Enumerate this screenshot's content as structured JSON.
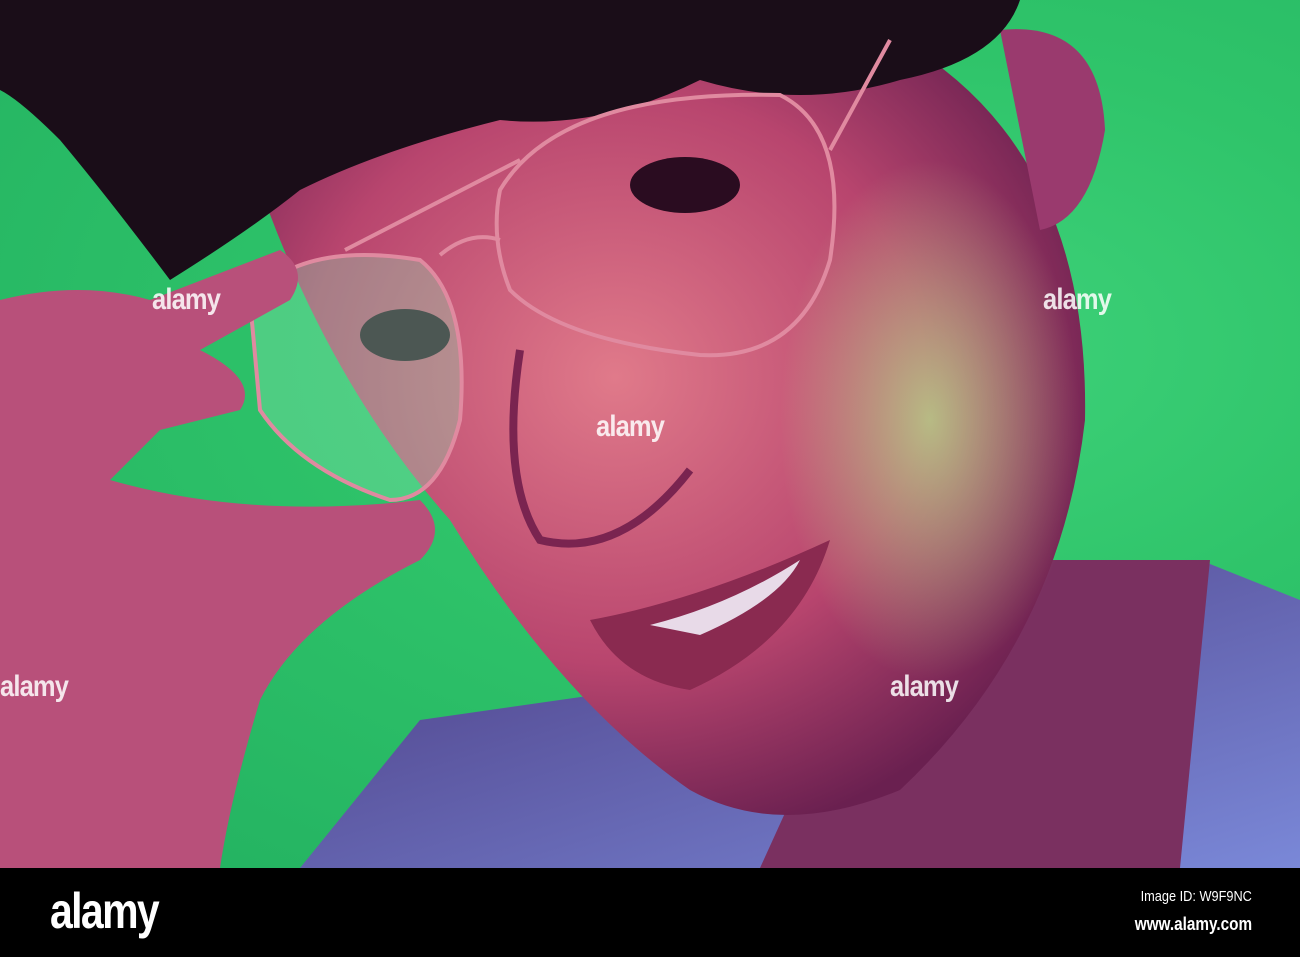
{
  "photo": {
    "subject": "portrait",
    "colors": {
      "background": "#2fc46a",
      "skin": "#c8587a",
      "hair": "#1a0d18",
      "shirt": "#6a78c8",
      "glasses": "#e08aa0"
    },
    "watermark_text": "alamy"
  },
  "footer": {
    "logo": "alamy",
    "image_id": "Image ID: W9F9NC",
    "url": "www.alamy.com"
  }
}
